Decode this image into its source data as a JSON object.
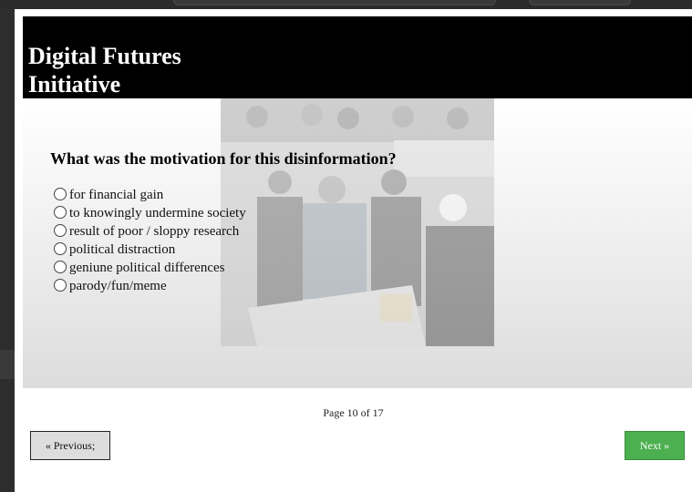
{
  "header": {
    "title": "Digital Futures Initiative"
  },
  "survey": {
    "question": "What was the motivation for this disinformation?",
    "options": [
      "for financial gain",
      "to knowingly undermine society",
      "result of poor / sloppy research",
      "political distraction",
      "geniune political differences",
      "parody/fun/meme"
    ]
  },
  "pagination": {
    "page_info": "Page 10 of 17",
    "previous_label": "« Previous;",
    "next_label": "Next »"
  },
  "colors": {
    "header_bg": "#000000",
    "next_button": "#4caf50",
    "previous_button": "#dddddd"
  }
}
